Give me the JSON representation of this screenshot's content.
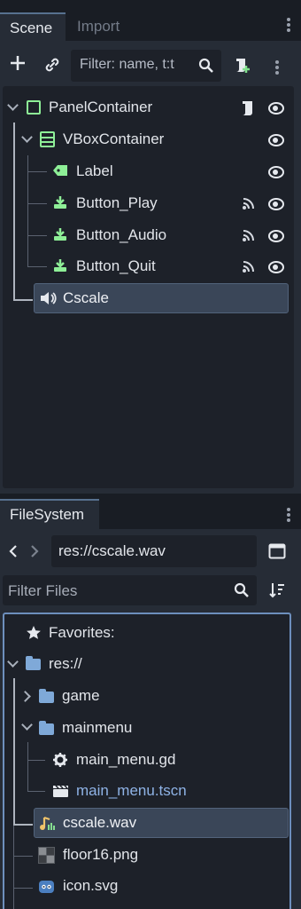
{
  "scene_dock": {
    "tabs": [
      "Scene",
      "Import"
    ],
    "filter_placeholder": "Filter: name, t:t",
    "tree": [
      {
        "label": "PanelContainer"
      },
      {
        "label": "VBoxContainer"
      },
      {
        "label": "Label"
      },
      {
        "label": "Button_Play"
      },
      {
        "label": "Button_Audio"
      },
      {
        "label": "Button_Quit"
      },
      {
        "label": "Cscale"
      }
    ]
  },
  "filesystem": {
    "tab": "FileSystem",
    "path": "res://cscale.wav",
    "filter_placeholder": "Filter Files",
    "tree": [
      {
        "label": "Favorites:"
      },
      {
        "label": "res://"
      },
      {
        "label": "game"
      },
      {
        "label": "mainmenu"
      },
      {
        "label": "main_menu.gd"
      },
      {
        "label": "main_menu.tscn"
      },
      {
        "label": "cscale.wav"
      },
      {
        "label": "floor16.png"
      },
      {
        "label": "icon.svg"
      }
    ]
  },
  "colors": {
    "node_green": "#8eef97",
    "folder_blue": "#7fa9d8",
    "scene_link": "#8fb3e6",
    "selection": "#3a4658"
  }
}
